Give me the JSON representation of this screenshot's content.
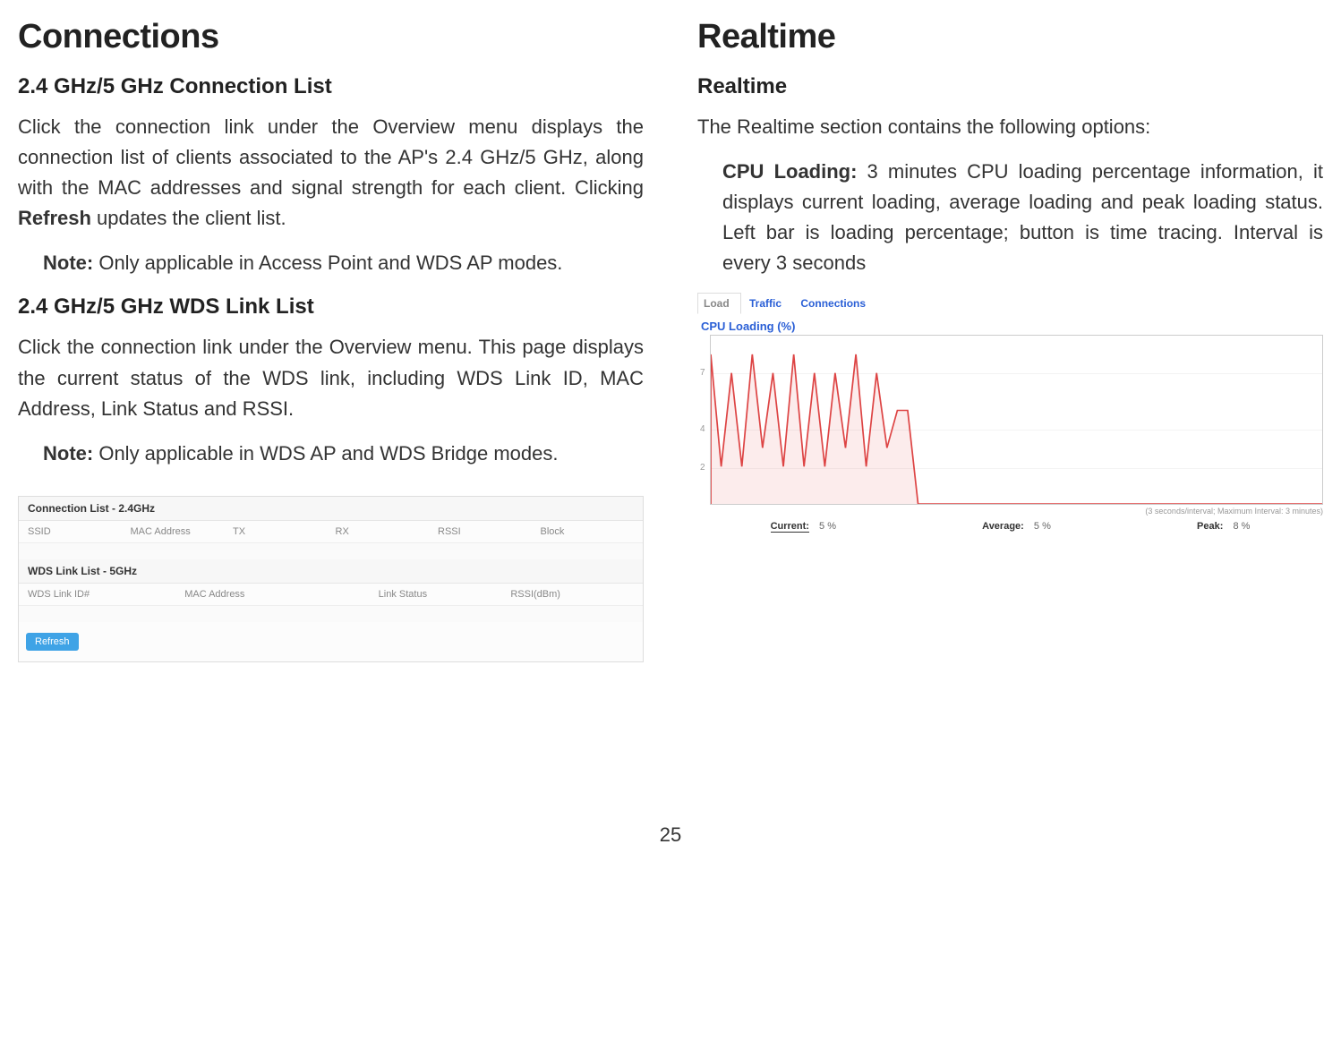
{
  "left": {
    "title": "Connections",
    "sec1_heading": "2.4 GHz/5 GHz Connection List",
    "sec1_para_a": "Click the connection link under the Overview menu displays the connection list of clients associated to the AP's 2.4 GHz/5 GHz, along with the MAC addresses and signal strength for each client. Clicking ",
    "sec1_para_bold": "Refresh",
    "sec1_para_b": " updates the client list.",
    "sec1_note_label": "Note:",
    "sec1_note_text": " Only applicable in Access Point and WDS AP modes.",
    "sec2_heading": "2.4 GHz/5 GHz WDS Link List",
    "sec2_para": "Click the connection link under the Overview menu. This page displays the current status of the WDS link, including WDS Link ID, MAC Address, Link Status and RSSI.",
    "sec2_note_label": "Note:",
    "sec2_note_text": " Only applicable in WDS AP and WDS Bridge modes.",
    "connlist": {
      "header1": "Connection List - 2.4GHz",
      "cols1": [
        "SSID",
        "MAC Address",
        "TX",
        "RX",
        "RSSI",
        "Block"
      ],
      "header2": "WDS Link List - 5GHz",
      "cols2": [
        "WDS Link ID#",
        "MAC Address",
        "Link Status",
        "RSSI(dBm)"
      ],
      "refresh": "Refresh"
    }
  },
  "right": {
    "title": "Realtime",
    "sec1_heading": "Realtime",
    "sec1_intro": "The Realtime section contains the following options:",
    "cpu_label": "CPU Loading:",
    "cpu_text": " 3 minutes CPU loading percentage information, it displays current loading, average loading and peak loading status. Left bar is loading percentage; button is time tracing. Interval is every 3 seconds",
    "tabs": [
      "Load",
      "Traffic",
      "Connections"
    ],
    "chart_title": "CPU Loading (%)",
    "chart_note": "(3 seconds/interval; Maximum Interval: 3 minutes)",
    "stats": {
      "current_label": "Current:",
      "current_val": "5 %",
      "average_label": "Average:",
      "average_val": "5 %",
      "peak_label": "Peak:",
      "peak_val": "8 %"
    }
  },
  "page_number": "25",
  "chart_data": {
    "type": "line",
    "title": "CPU Loading (%)",
    "xlabel": "",
    "ylabel": "",
    "ylim": [
      0,
      9
    ],
    "yticks": [
      2,
      4,
      7
    ],
    "interval_note": "3 seconds/interval; Maximum Interval: 3 minutes",
    "values": [
      8,
      2,
      7,
      2,
      8,
      3,
      7,
      2,
      8,
      2,
      7,
      2,
      7,
      3,
      8,
      2,
      7,
      3,
      5,
      5,
      0,
      0,
      0,
      0,
      0,
      0,
      0,
      0,
      0,
      0,
      0,
      0,
      0,
      0,
      0,
      0,
      0,
      0,
      0,
      0,
      0,
      0,
      0,
      0,
      0,
      0,
      0,
      0,
      0,
      0,
      0,
      0,
      0,
      0,
      0,
      0,
      0,
      0,
      0,
      0
    ],
    "stats": {
      "current": 5,
      "average": 5,
      "peak": 8
    }
  }
}
